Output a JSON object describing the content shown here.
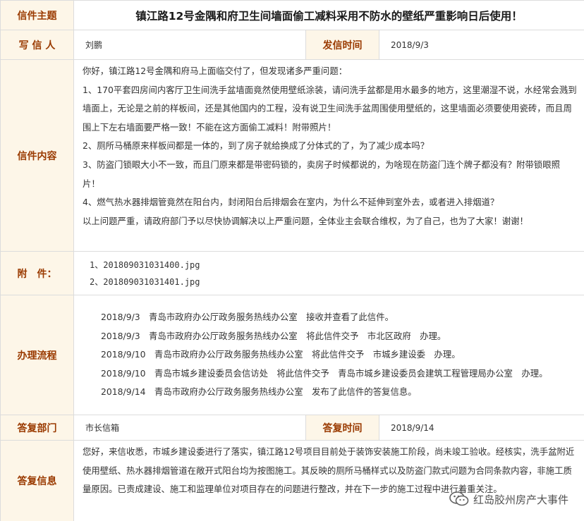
{
  "subject": {
    "label": "信件主题",
    "value": "镇江路12号金隅和府卫生间墙面偷工减料采用不防水的壁纸严重影响日后使用！"
  },
  "writer": {
    "label": "写 信 人",
    "value": "刘鹏"
  },
  "sent_time": {
    "label": "发信时间",
    "value": "2018/9/3"
  },
  "letter": {
    "label": "信件内容",
    "paragraphs": [
      "你好，镇江路12号金隅和府马上面临交付了，但发现诸多严重问题：",
      "1、170平套四房间内客厅卫生间洗手盆墙面竟然使用壁纸涂装，请问洗手盆都是用水最多的地方，这里潮湿不说，水经常会溅到墙面上，无论是之前的样板间，还是其他国内的工程，没有说卫生间洗手盆周围使用壁纸的，这里墙面必须要使用瓷砖，而且周围上下左右墙面要严格一致！不能在这方面偷工减料！附带照片！",
      "2、厕所马桶原来样板间都是一体的，到了房子就给换成了分体式的了，为了减少成本吗？",
      "3、防盗门锁眼大小不一致，而且门原来都是带密码锁的，卖房子时候都说的，为啥现在防盗门连个牌子都没有？附带锁眼照片！",
      "4、燃气热水器排烟管竟然在阳台内，封闭阳台后排烟会在室内，为什么不延伸到室外去，或者进入排烟道？",
      "以上问题严重，请政府部门予以尽快协调解决以上严重问题，全体业主会联合维权，为了自己，也为了大家！谢谢！"
    ]
  },
  "attachments": {
    "label": "附　件：",
    "items": [
      "1、201809031031400.jpg",
      "2、201809031031401.jpg"
    ]
  },
  "process": {
    "label": "办理流程",
    "entries": [
      "2018/9/3　青岛市政府办公厅政务服务热线办公室　接收并查看了此信件。",
      "2018/9/3　青岛市政府办公厅政务服务热线办公室　将此信件交予　市北区政府　办理。",
      "2018/9/10　青岛市政府办公厅政务服务热线办公室　将此信件交予　市城乡建设委　办理。",
      "2018/9/10　青岛市城乡建设委员会信访处　将此信件交予　青岛市城乡建设委员会建筑工程管理局办公室　办理。",
      "2018/9/14　青岛市政府办公厅政务服务热线办公室　发布了此信件的答复信息。"
    ]
  },
  "reply_dept": {
    "label": "答复部门",
    "value": "市长信箱"
  },
  "reply_time": {
    "label": "答复时间",
    "value": "2018/9/14"
  },
  "reply": {
    "label": "答复信息",
    "text": "您好，来信收悉，市城乡建设委进行了落实，镇江路12号项目目前处于装饰安装施工阶段，尚未竣工验收。经核实，洗手盆附近使用壁纸、热水器排烟管道在敞开式阳台均为按图施工。其反映的厕所马桶样式以及防盗门款式问题为合同条款内容，非施工质量原因。已责成建设、施工和监理单位对项目存在的问题进行整改，并在下一步的施工过程中进行着重关注。"
  },
  "watermark": {
    "text": "红岛胶州房产大事件",
    "icon": "wechat-icon"
  },
  "colors": {
    "label_bg": "#fdf6e8",
    "label_text": "#9a3a00",
    "border": "#dcdcdc"
  }
}
